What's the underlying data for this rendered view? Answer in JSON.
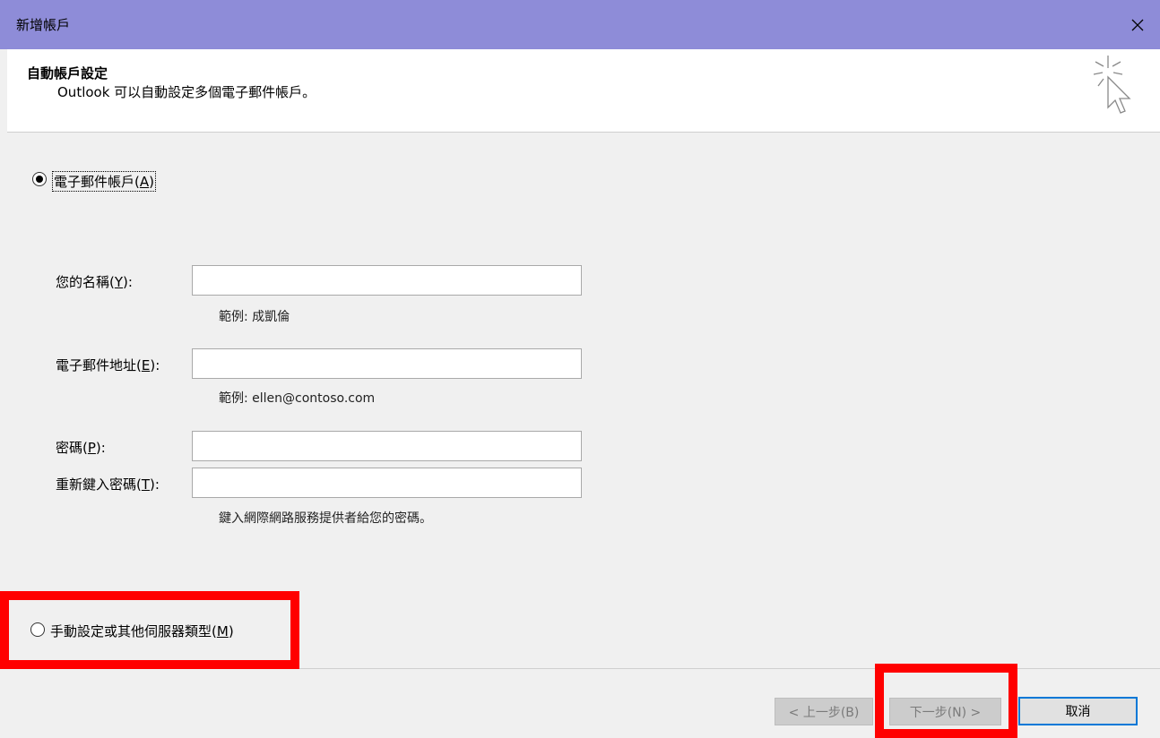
{
  "window": {
    "title": "新增帳戶",
    "close_glyph": "✕"
  },
  "header": {
    "title": "自動帳戶設定",
    "description": "Outlook 可以自動設定多個電子郵件帳戶。",
    "icon": "cursor-sparkle-icon"
  },
  "email_account_option": {
    "label": "電子郵件帳戶",
    "accel": "(A)",
    "accel_key": "A",
    "selected": true
  },
  "fields": {
    "name": {
      "label": "您的名稱",
      "accel_key": "Y",
      "value": "",
      "hint": "範例: 成凱倫"
    },
    "email": {
      "label": "電子郵件地址",
      "accel_key": "E",
      "value": "",
      "hint": "範例: ellen@contoso.com"
    },
    "password": {
      "label": "密碼",
      "accel_key": "P",
      "value": ""
    },
    "retype_password": {
      "label": "重新鍵入密碼",
      "accel_key": "T",
      "value": "",
      "hint": "鍵入網際網路服務提供者給您的密碼。"
    }
  },
  "manual_option": {
    "label": "手動設定或其他伺服器類型",
    "accel_key": "M",
    "selected": false
  },
  "buttons": {
    "back": {
      "label": "< 上一步(B)",
      "enabled": false
    },
    "next": {
      "label": "下一步(N) >",
      "enabled": false
    },
    "cancel": {
      "label": "取消",
      "enabled": true
    }
  },
  "colors": {
    "title_bar": "#8e8cd8",
    "highlight": "#ff0000",
    "focus": "#0078d7"
  }
}
